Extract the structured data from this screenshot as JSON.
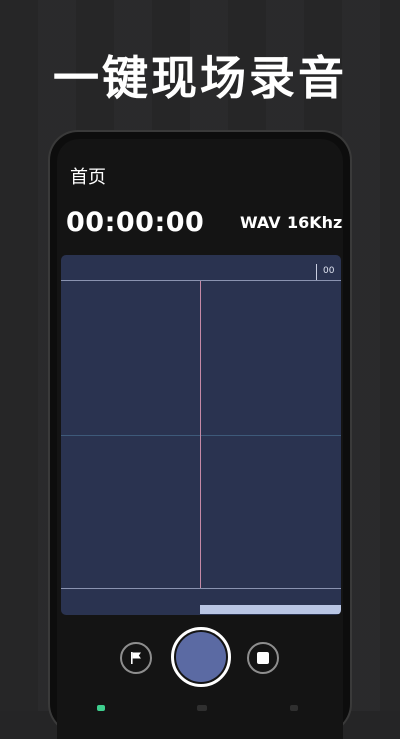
{
  "promo": {
    "headline": "一键现场录音"
  },
  "screen": {
    "nav_title": "首页",
    "timer": "00:00:00",
    "format": "WAV",
    "sample_rate": "16Khz",
    "ruler_label": "00"
  },
  "controls": {
    "flag_icon": "flag-icon",
    "record_icon": "record-icon",
    "stop_icon": "stop-icon"
  },
  "colors": {
    "wave_panel": "#2a3350",
    "record_button": "#5b6aa3",
    "playhead": "#c58aa6",
    "scrollbar": "#b9c6e4"
  }
}
